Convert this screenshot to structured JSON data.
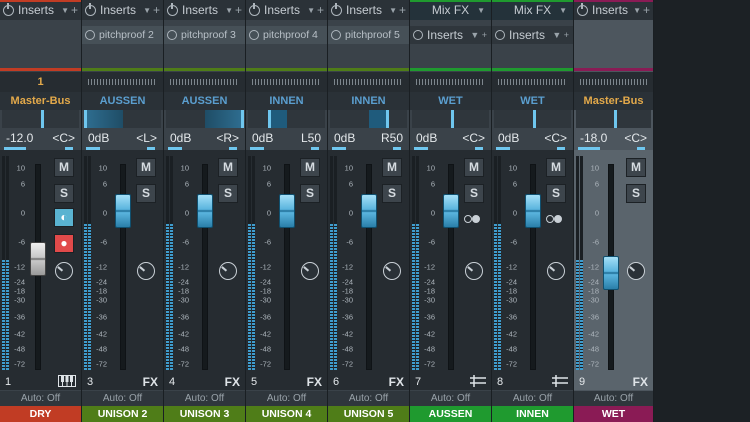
{
  "colors": {
    "red": "#c13c24",
    "green": "#1f9a2f",
    "olive": "#4f7d18",
    "purple": "#8a1b55",
    "blue": "#6fc6ee",
    "gold": "#e3a94a"
  },
  "channels": [
    {
      "id": 1,
      "top": "Inserts",
      "insert": "",
      "dest": "Master-Bus",
      "dest_style": "gold",
      "top_num": "1",
      "volume": "-12.0",
      "pan": "<C>",
      "number": "1",
      "icon": "piano-icon",
      "icon_text": "",
      "auto": "Auto: Off",
      "name": "DRY",
      "name_color": "#c13c24",
      "knob": "grey",
      "fader_level": 0.47,
      "extra": true
    },
    {
      "id": 2,
      "top": "Inserts",
      "insert": "pitchproof 2",
      "dest": "AUSSEN",
      "volume": "0dB",
      "pan": "<L>",
      "number": "3",
      "icon": "fx-icon",
      "icon_text": "FX",
      "auto": "Auto: Off",
      "name": "UNISON 2",
      "name_color": "#4f7d18",
      "pan_pos": "left"
    },
    {
      "id": 3,
      "top": "Inserts",
      "insert": "pitchproof 3",
      "dest": "AUSSEN",
      "volume": "0dB",
      "pan": "<R>",
      "number": "4",
      "icon": "fx-icon",
      "icon_text": "FX",
      "auto": "Auto: Off",
      "name": "UNISON 3",
      "name_color": "#4f7d18",
      "pan_pos": "right"
    },
    {
      "id": 4,
      "top": "Inserts",
      "insert": "pitchproof 4",
      "dest": "INNEN",
      "volume": "0dB",
      "pan": "L50",
      "number": "5",
      "icon": "fx-icon",
      "icon_text": "FX",
      "auto": "Auto: Off",
      "name": "UNISON 4",
      "name_color": "#4f7d18",
      "pan_pos": "l50"
    },
    {
      "id": 5,
      "top": "Inserts",
      "insert": "pitchproof 5",
      "dest": "INNEN",
      "volume": "0dB",
      "pan": "R50",
      "number": "6",
      "icon": "fx-icon",
      "icon_text": "FX",
      "auto": "Auto: Off",
      "name": "UNISON 5",
      "name_color": "#4f7d18",
      "pan_pos": "r50"
    },
    {
      "id": 6,
      "top": "Mix FX",
      "insert": "Inserts",
      "dest": "WET",
      "volume": "0dB",
      "pan": "<C>",
      "number": "7",
      "icon": "bus-icon",
      "icon_text": "",
      "auto": "Auto: Off",
      "name": "AUSSEN",
      "name_color": "#1f9a2f",
      "bus": true
    },
    {
      "id": 7,
      "top": "Mix FX",
      "insert": "Inserts",
      "dest": "WET",
      "volume": "0dB",
      "pan": "<C>",
      "number": "8",
      "icon": "bus-icon",
      "icon_text": "",
      "auto": "Auto: Off",
      "name": "INNEN",
      "name_color": "#1f9a2f",
      "bus": true
    },
    {
      "id": 8,
      "top": "Inserts",
      "insert": "",
      "dest": "Master-Bus",
      "dest_style": "gold",
      "volume": "-18.0",
      "pan": "<C>",
      "number": "9",
      "icon": "fx-icon",
      "icon_text": "FX",
      "auto": "Auto: Off",
      "name": "WET",
      "name_color": "#8a1b55",
      "knob": "blue-low",
      "fader_level": 0.4,
      "selected": true
    }
  ],
  "meter_scale": [
    "10",
    "6",
    "0",
    "-6",
    "-12",
    "-18",
    "-24",
    "-30",
    "-36",
    "-42",
    "-48",
    "-72"
  ],
  "buttons": {
    "mute": "M",
    "solo": "S"
  }
}
